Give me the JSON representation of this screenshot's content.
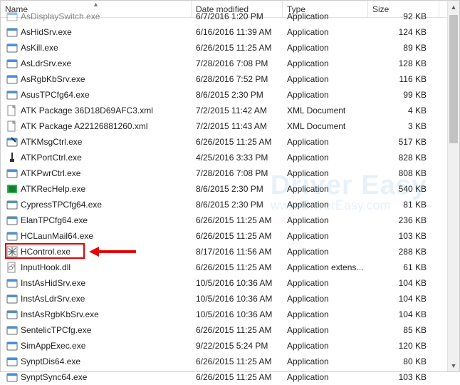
{
  "columns": {
    "name": "Name",
    "date": "Date modified",
    "type": "Type",
    "size": "Size"
  },
  "watermark": {
    "title": "Driver Easy",
    "sub": "www.DriverEasy.com"
  },
  "files": [
    {
      "icon": "app",
      "name": "AsDisplaySwitch.exe",
      "date": "6/7/2016 1:20 PM",
      "type": "Application",
      "size": "92 KB",
      "cut": true
    },
    {
      "icon": "app",
      "name": "AsHidSrv.exe",
      "date": "6/16/2016 11:39 AM",
      "type": "Application",
      "size": "124 KB"
    },
    {
      "icon": "app",
      "name": "AsKill.exe",
      "date": "6/26/2015 11:25 AM",
      "type": "Application",
      "size": "89 KB"
    },
    {
      "icon": "app",
      "name": "AsLdrSrv.exe",
      "date": "7/28/2016 7:08 PM",
      "type": "Application",
      "size": "128 KB"
    },
    {
      "icon": "app",
      "name": "AsRgbKbSrv.exe",
      "date": "6/28/2016 7:52 PM",
      "type": "Application",
      "size": "116 KB"
    },
    {
      "icon": "app",
      "name": "AsusTPCfg64.exe",
      "date": "8/6/2015 2:30 PM",
      "type": "Application",
      "size": "99 KB"
    },
    {
      "icon": "xml",
      "name": "ATK Package 36D18D69AFC3.xml",
      "date": "7/2/2015 11:42 AM",
      "type": "XML Document",
      "size": "4 KB"
    },
    {
      "icon": "xml",
      "name": "ATK Package A22126881260.xml",
      "date": "7/2/2015 11:43 AM",
      "type": "XML Document",
      "size": "3 KB"
    },
    {
      "icon": "app2",
      "name": "ATKMsgCtrl.exe",
      "date": "6/26/2015 11:25 AM",
      "type": "Application",
      "size": "517 KB"
    },
    {
      "icon": "port",
      "name": "ATKPortCtrl.exe",
      "date": "4/25/2016 3:33 PM",
      "type": "Application",
      "size": "828 KB"
    },
    {
      "icon": "app",
      "name": "ATKPwrCtrl.exe",
      "date": "7/28/2016 7:08 PM",
      "type": "Application",
      "size": "808 KB"
    },
    {
      "icon": "rec",
      "name": "ATKRecHelp.exe",
      "date": "8/6/2015 2:30 PM",
      "type": "Application",
      "size": "540 KB"
    },
    {
      "icon": "app",
      "name": "CypressTPCfg64.exe",
      "date": "8/6/2015 2:30 PM",
      "type": "Application",
      "size": "81 KB"
    },
    {
      "icon": "app",
      "name": "ElanTPCfg64.exe",
      "date": "6/26/2015 11:25 AM",
      "type": "Application",
      "size": "236 KB"
    },
    {
      "icon": "app",
      "name": "HCLaunMail64.exe",
      "date": "6/26/2015 11:25 AM",
      "type": "Application",
      "size": "103 KB"
    },
    {
      "icon": "hc",
      "name": "HControl.exe",
      "date": "8/17/2016 11:56 AM",
      "type": "Application",
      "size": "288 KB",
      "highlight": true
    },
    {
      "icon": "dll",
      "name": "InputHook.dll",
      "date": "6/26/2015 11:25 AM",
      "type": "Application extens...",
      "size": "61 KB"
    },
    {
      "icon": "app",
      "name": "InstAsHidSrv.exe",
      "date": "10/5/2016 10:36 AM",
      "type": "Application",
      "size": "104 KB"
    },
    {
      "icon": "app",
      "name": "InstAsLdrSrv.exe",
      "date": "10/5/2016 10:36 AM",
      "type": "Application",
      "size": "104 KB"
    },
    {
      "icon": "app",
      "name": "InstAsRgbKbSrv.exe",
      "date": "10/5/2016 10:36 AM",
      "type": "Application",
      "size": "104 KB"
    },
    {
      "icon": "app",
      "name": "SentelicTPCfg.exe",
      "date": "6/26/2015 11:25 AM",
      "type": "Application",
      "size": "85 KB"
    },
    {
      "icon": "app",
      "name": "SimAppExec.exe",
      "date": "9/22/2015 5:24 PM",
      "type": "Application",
      "size": "120 KB"
    },
    {
      "icon": "app",
      "name": "SynptDis64.exe",
      "date": "6/26/2015 11:25 AM",
      "type": "Application",
      "size": "80 KB"
    },
    {
      "icon": "app",
      "name": "SynptSync64.exe",
      "date": "6/26/2015 11:25 AM",
      "type": "Application",
      "size": "103 KB"
    }
  ]
}
